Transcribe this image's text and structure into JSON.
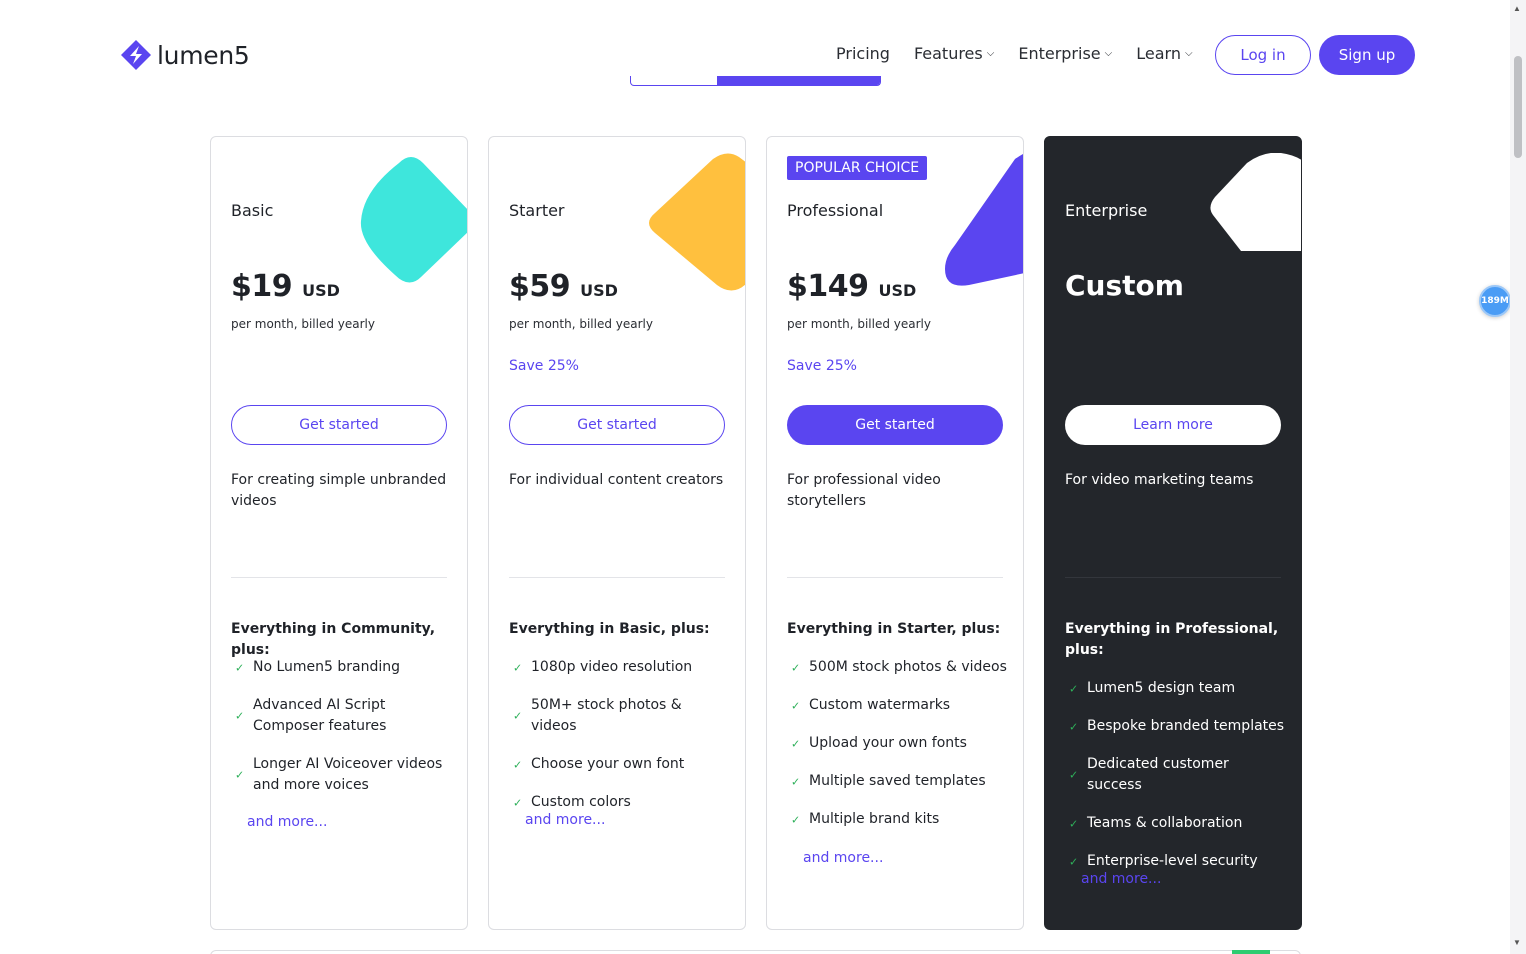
{
  "header": {
    "logo_text": "lumen5",
    "nav": [
      {
        "label": "Pricing",
        "has_dropdown": false
      },
      {
        "label": "Features",
        "has_dropdown": true
      },
      {
        "label": "Enterprise",
        "has_dropdown": true
      },
      {
        "label": "Learn",
        "has_dropdown": true
      }
    ],
    "login_label": "Log in",
    "signup_label": "Sign up"
  },
  "plans": [
    {
      "name": "Basic",
      "price": "$19",
      "currency": "USD",
      "billing": "per month, billed yearly",
      "save": "",
      "cta": "Get started",
      "description": "For creating simple unbranded videos",
      "features_heading": "Everything in Community, plus:",
      "features": [
        "No Lumen5 branding",
        "Advanced AI Script Composer features",
        "Longer AI Voiceover videos and more voices"
      ],
      "more": "and more...",
      "shape_color": "#3ee6dc"
    },
    {
      "name": "Starter",
      "price": "$59",
      "currency": "USD",
      "billing": "per month, billed yearly",
      "save": "Save 25%",
      "cta": "Get started",
      "description": "For individual content creators",
      "features_heading": "Everything in Basic, plus:",
      "features": [
        "1080p video resolution",
        "50M+ stock photos & videos",
        "Choose your own font",
        "Custom colors"
      ],
      "more": "and more...",
      "shape_color": "#ffc03e"
    },
    {
      "name": "Professional",
      "badge": "POPULAR CHOICE",
      "price": "$149",
      "currency": "USD",
      "billing": "per month, billed yearly",
      "save": "Save 25%",
      "cta": "Get started",
      "description": "For professional video storytellers",
      "features_heading": "Everything in Starter, plus:",
      "features": [
        "500M stock photos & videos",
        "Custom watermarks",
        "Upload your own fonts",
        "Multiple saved templates",
        "Multiple brand kits"
      ],
      "more": "and more...",
      "shape_color": "#5a45f0"
    },
    {
      "name": "Enterprise",
      "price": "Custom",
      "cta": "Learn more",
      "description": "For video marketing teams",
      "features_heading": "Everything in Professional, plus:",
      "features": [
        "Lumen5 design team",
        "Bespoke branded templates",
        "Dedicated customer success",
        "Teams & collaboration",
        "Enterprise-level security"
      ],
      "more": "and more...",
      "shape_color": "#ffffff"
    }
  ],
  "floating_badge": "189M",
  "colors": {
    "accent": "#5a45f0",
    "dark_card": "#23262b",
    "check": "#2eb05a"
  }
}
